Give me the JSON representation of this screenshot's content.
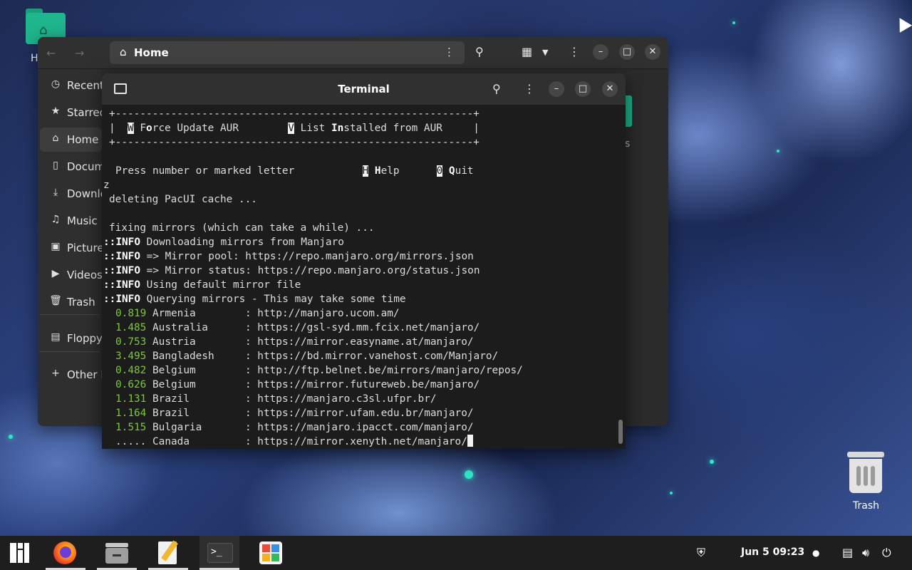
{
  "desktop": {
    "home_label": "H",
    "trash_label": "Trash"
  },
  "file_manager": {
    "path_label": "Home",
    "sidebar": [
      {
        "label": "Recent",
        "icon": "clock-icon"
      },
      {
        "label": "Starred",
        "icon": "star-icon"
      },
      {
        "label": "Home",
        "icon": "home-icon",
        "active": true
      },
      {
        "label": "Documents",
        "icon": "document-icon"
      },
      {
        "label": "Downloads",
        "icon": "download-icon"
      },
      {
        "label": "Music",
        "icon": "music-icon"
      },
      {
        "label": "Pictures",
        "icon": "picture-icon"
      },
      {
        "label": "Videos",
        "icon": "video-icon"
      },
      {
        "label": "Trash",
        "icon": "trash-icon"
      },
      {
        "label": "Floppy Disk",
        "icon": "floppy-icon"
      },
      {
        "label": "Other Locations",
        "icon": "plus-icon"
      }
    ],
    "partial_text": "s"
  },
  "terminal": {
    "title": "Terminal",
    "lines": {
      "border1": "+----------------------------------------------------------+",
      "border2": "+----------------------------------------------------------+",
      "menu": {
        "key_w": "W",
        "w_pre": "F",
        "w_bold": "o",
        "w_rest": "rce Update AUR",
        "key_v": "V",
        "v_pre": "List ",
        "v_bold": "In",
        "v_rest": "stalled from AUR"
      },
      "prompt": "Press number or marked letter",
      "key_h": "H",
      "help_bold": "H",
      "help_rest": "elp",
      "key_0": "0",
      "quit_bold": "Q",
      "quit_rest": "uit",
      "typed": "z",
      "deleting": "deleting PacUI cache ...",
      "fixing": "fixing mirrors (which can take a while) ...",
      "info": [
        "Downloading mirrors from Manjaro",
        "=> Mirror pool: https://repo.manjaro.org/mirrors.json",
        "=> Mirror status: https://repo.manjaro.org/status.json",
        "Using default mirror file",
        "Querying mirrors - This may take some time"
      ],
      "info_prefix": "::INFO",
      "mirrors": [
        {
          "time": "0.819",
          "country": "Armenia",
          "url": "http://manjaro.ucom.am/"
        },
        {
          "time": "1.485",
          "country": "Australia",
          "url": "https://gsl-syd.mm.fcix.net/manjaro/"
        },
        {
          "time": "0.753",
          "country": "Austria",
          "url": "https://mirror.easyname.at/manjaro/"
        },
        {
          "time": "3.495",
          "country": "Bangladesh",
          "url": "https://bd.mirror.vanehost.com/Manjaro/"
        },
        {
          "time": "0.482",
          "country": "Belgium",
          "url": "http://ftp.belnet.be/mirrors/manjaro/repos/"
        },
        {
          "time": "0.626",
          "country": "Belgium",
          "url": "https://mirror.futureweb.be/manjaro/"
        },
        {
          "time": "1.131",
          "country": "Brazil",
          "url": "https://manjaro.c3sl.ufpr.br/"
        },
        {
          "time": "1.164",
          "country": "Brazil",
          "url": "https://mirror.ufam.edu.br/manjaro/"
        },
        {
          "time": "1.515",
          "country": "Bulgaria",
          "url": "https://manjaro.ipacct.com/manjaro/"
        },
        {
          "time": ".....",
          "country": "Canada",
          "url": "https://mirror.xenyth.net/manjaro/"
        }
      ]
    }
  },
  "taskbar": {
    "apps": [
      "manjaro-menu-icon",
      "firefox-icon",
      "files-icon",
      "text-editor-icon",
      "terminal-icon",
      "software-icon"
    ],
    "clock": "Jun 5  09:23"
  },
  "colors": {
    "accent_green": "#1fb58d",
    "terminal_bg": "#1c1c1c",
    "mirror_time": "#7ec73b"
  }
}
